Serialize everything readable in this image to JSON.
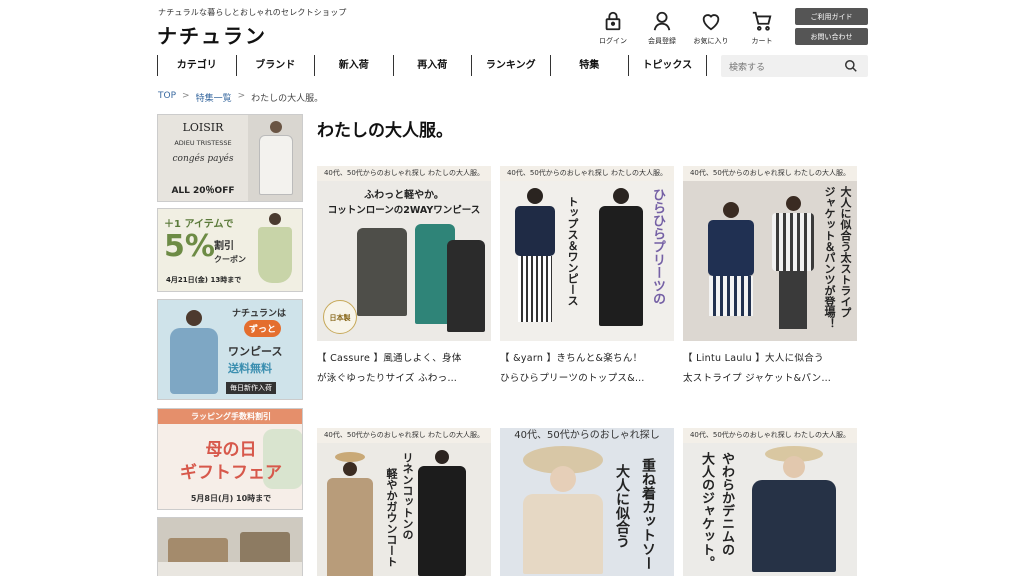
{
  "header": {
    "tagline": "ナチュラルな暮らしとおしゃれのセレクトショップ",
    "logo": "ナチュラン",
    "utility": [
      {
        "label": "ログイン",
        "icon": "lock-icon"
      },
      {
        "label": "会員登録",
        "icon": "person-icon"
      },
      {
        "label": "お気に入り",
        "icon": "heart-icon"
      },
      {
        "label": "カート",
        "icon": "cart-icon"
      }
    ],
    "guide_button": "ご利用ガイド",
    "contact_button": "お問い合わせ"
  },
  "nav": {
    "items": [
      "カテゴリ",
      "ブランド",
      "新入荷",
      "再入荷",
      "ランキング",
      "特集",
      "トピックス"
    ],
    "search_placeholder": "検索する"
  },
  "breadcrumb": {
    "items": [
      "TOP",
      "特集一覧",
      "わたしの大人服。"
    ],
    "separator": ">"
  },
  "sidebar": {
    "banner1": {
      "lines": [
        "LOISIR",
        "ADIEU TRISTESSE",
        "congés payés",
        "ALL 20％OFF"
      ]
    },
    "banner2": {
      "lines": [
        "＋1 アイテムで",
        "5%",
        "割引",
        "クーポン",
        "4月21日(金) 13時まで"
      ]
    },
    "banner3": {
      "lines": [
        "ナチュランは",
        "ずっと",
        "ワンピース",
        "送料無料",
        "毎日新作入荷"
      ]
    },
    "banner4": {
      "lines": [
        "ラッピング手数料割引",
        "母の日",
        "ギフトフェア",
        "5月8日(月) 10時まで"
      ]
    }
  },
  "main": {
    "title": "わたしの大人服。",
    "cards": [
      {
        "header": "40代、50代からのおしゃれ探し わたしの大人服。",
        "thumb_text": [
          "ふわっと軽やか。",
          "コットンローンの2WAYワンピース",
          "日本製"
        ],
        "desc_line1": "【 Cassure 】風通しよく、身体",
        "desc_line2": "が泳ぐゆったりサイズ ふわっ…"
      },
      {
        "header": "40代、50代からのおしゃれ探し わたしの大人服。",
        "thumb_text": [
          "ひらひらプリーツの",
          "トップス＆ワンピース"
        ],
        "desc_line1": "【 &yarn 】きちんと&楽ちん！",
        "desc_line2": "ひらひらプリーツのトップス&…"
      },
      {
        "header": "40代、50代からのおしゃれ探し わたしの大人服。",
        "thumb_text": [
          "大人に似合う太ストライプ",
          "ジャケット＆パンツが登場！"
        ],
        "desc_line1": "【 Lintu Laulu 】大人に似合う",
        "desc_line2": "太ストライプ ジャケット&パン…"
      },
      {
        "header": "40代、50代からのおしゃれ探し わたしの大人服。",
        "thumb_text": [
          "リネンコットンの",
          "軽やかガウンコート"
        ]
      },
      {
        "header": "40代、50代からのおしゃれ探し",
        "thumb_text": [
          "大人に似合う",
          "重ね着カットソー"
        ]
      },
      {
        "header": "40代、50代からのおしゃれ探し わたしの大人服。",
        "thumb_text": [
          "やわらかデニムの",
          "大人のジャケット。"
        ]
      }
    ]
  },
  "colors": {
    "button_bg": "#555555",
    "link": "#3a6aa0",
    "accent_red": "#c23b2e"
  }
}
